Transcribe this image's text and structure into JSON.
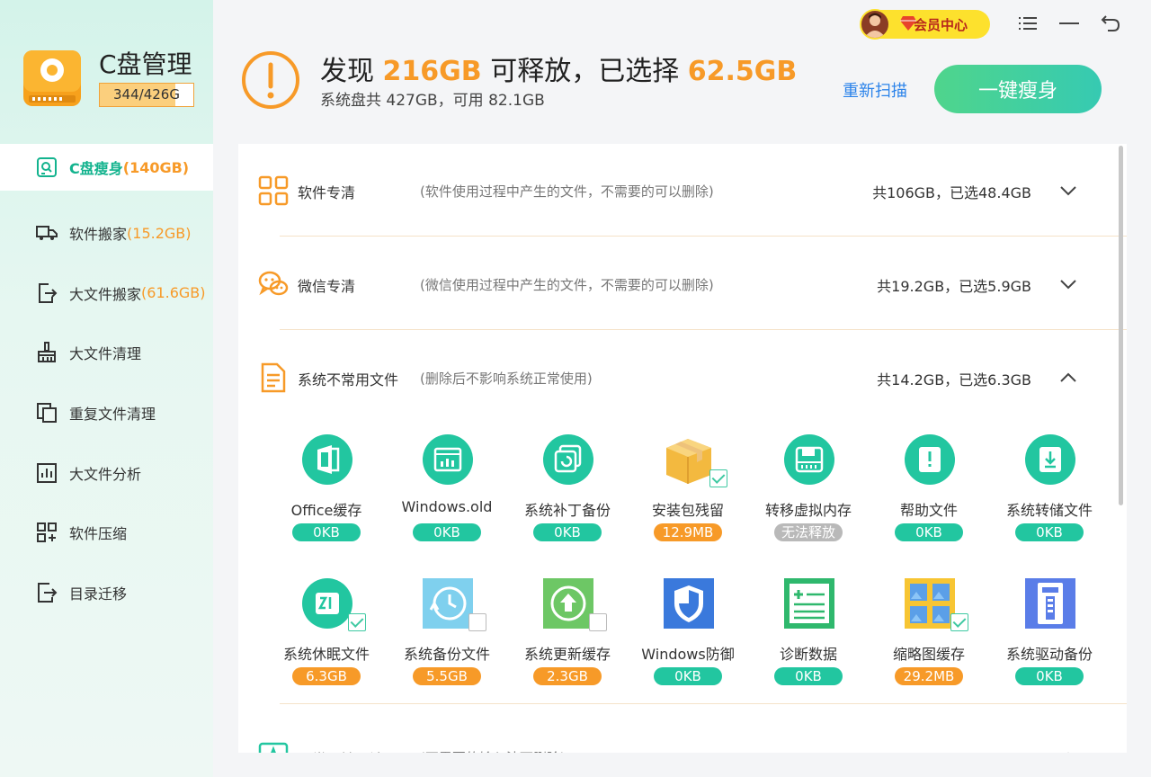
{
  "app": {
    "title": "C盘管理",
    "disk_usage": "344/426G",
    "disk_used_fraction": 0.81
  },
  "sidebar": {
    "items": [
      {
        "label": "C盘瘦身",
        "extra": "(140GB)",
        "icon": "disk-search-icon",
        "active": true
      },
      {
        "label": "软件搬家",
        "extra": "(15.2GB)",
        "icon": "truck-icon"
      },
      {
        "label": "大文件搬家",
        "extra": "(61.6GB)",
        "icon": "file-export-icon"
      },
      {
        "label": "大文件清理",
        "extra": "",
        "icon": "broom-icon"
      },
      {
        "label": "重复文件清理",
        "extra": "",
        "icon": "duplicate-icon"
      },
      {
        "label": "大文件分析",
        "extra": "",
        "icon": "chart-icon"
      },
      {
        "label": "软件压缩",
        "extra": "",
        "icon": "grid-compress-icon"
      },
      {
        "label": "目录迁移",
        "extra": "",
        "icon": "folder-move-icon"
      }
    ]
  },
  "titlebar": {
    "vip_label": "会员中心"
  },
  "header": {
    "prefix": "发现",
    "found": "216GB",
    "middle": "可释放，已选择",
    "selected": "62.5GB",
    "subline": "系统盘共 427GB，可用 82.1GB",
    "rescan": "重新扫描",
    "slim_button": "一键瘦身"
  },
  "categories": [
    {
      "name": "软件专清",
      "desc": "(软件使用过程中产生的文件，不需要的可以删除)",
      "stat": "共106GB，已选48.4GB",
      "expanded": false
    },
    {
      "name": "微信专清",
      "desc": "(微信使用过程中产生的文件，不需要的可以删除)",
      "stat": "共19.2GB，已选5.9GB",
      "expanded": false
    },
    {
      "name": "系统不常用文件",
      "desc": "(删除后不影响系统正常使用)",
      "stat": "共14.2GB，已选6.3GB",
      "expanded": true
    },
    {
      "name": "不常用输入法",
      "desc": "(不需要的输入法可删除)",
      "stat": "",
      "expanded": true
    }
  ],
  "tiles": [
    {
      "label": "Office缓存",
      "size": "0KB",
      "status": "green",
      "icon": "office-icon"
    },
    {
      "label": "Windows.old",
      "size": "0KB",
      "status": "green",
      "icon": "windows-old-icon"
    },
    {
      "label": "系统补丁备份",
      "size": "0KB",
      "status": "green",
      "icon": "patch-backup-icon"
    },
    {
      "label": "安装包残留",
      "size": "12.9MB",
      "status": "orange",
      "icon": "package-box-icon",
      "checked": true
    },
    {
      "label": "转移虚拟内存",
      "size": "无法释放",
      "status": "gray",
      "icon": "virtual-memory-icon"
    },
    {
      "label": "帮助文件",
      "size": "0KB",
      "status": "green",
      "icon": "help-file-icon"
    },
    {
      "label": "系统转储文件",
      "size": "0KB",
      "status": "green",
      "icon": "dump-file-icon"
    },
    {
      "label": "系统休眠文件",
      "size": "6.3GB",
      "status": "orange",
      "icon": "hibernate-icon",
      "checked": true
    },
    {
      "label": "系统备份文件",
      "size": "5.5GB",
      "status": "orange",
      "icon": "backup-clock-icon",
      "checked": false
    },
    {
      "label": "系统更新缓存",
      "size": "2.3GB",
      "status": "orange",
      "icon": "update-cache-icon",
      "checked": false
    },
    {
      "label": "Windows防御",
      "size": "0KB",
      "status": "green",
      "icon": "shield-icon"
    },
    {
      "label": "诊断数据",
      "size": "0KB",
      "status": "green",
      "icon": "diagnostic-icon"
    },
    {
      "label": "缩略图缓存",
      "size": "29.2MB",
      "status": "orange",
      "icon": "thumbnail-icon",
      "checked": true
    },
    {
      "label": "系统驱动备份",
      "size": "0KB",
      "status": "green",
      "icon": "driver-backup-icon"
    }
  ]
}
